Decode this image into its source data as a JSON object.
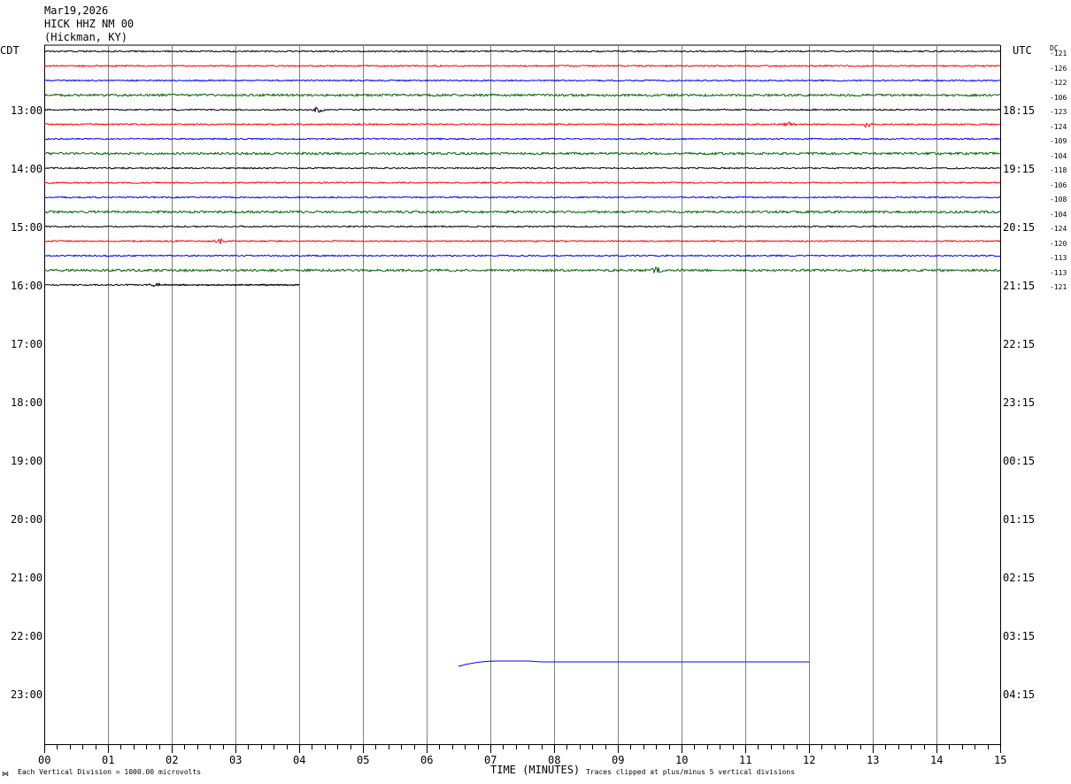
{
  "header": {
    "date": "Mar19,2026",
    "station": "HICK HHZ NM 00",
    "location": "(Hickman, KY)"
  },
  "left_axis_label": "CDT",
  "right_axis_label": "UTC",
  "dc_label": "DC",
  "footer": {
    "left_note": "Each Vertical Division = 1000.00 microvolts",
    "x_axis_title": "TIME (MINUTES)",
    "right_note": "Traces clipped at plus/minus 5 vertical divisions",
    "corner_mark": "⋈"
  },
  "colors": {
    "trace_cycle": [
      "#000000",
      "#ff0000",
      "#0000ff",
      "#006600"
    ],
    "gridline": "#808080"
  },
  "chart_data": {
    "type": "line",
    "subtype": "helicorder",
    "x_axis": {
      "label": "TIME (MINUTES)",
      "range": [
        0,
        15
      ],
      "tick_labels": [
        "00",
        "01",
        "02",
        "03",
        "04",
        "05",
        "06",
        "07",
        "08",
        "09",
        "10",
        "11",
        "12",
        "13",
        "14",
        "15"
      ]
    },
    "left_time_labels": [
      "13:00",
      "14:00",
      "15:00",
      "16:00",
      "17:00",
      "18:00",
      "19:00",
      "20:00",
      "21:00",
      "22:00",
      "23:00"
    ],
    "right_time_labels": [
      "18:15",
      "19:15",
      "20:15",
      "21:15",
      "22:15",
      "23:15",
      "00:15",
      "01:15",
      "02:15",
      "03:15",
      "04:15"
    ],
    "minutes_per_line": 15,
    "dc_offsets": [
      "-121",
      "-126",
      "-122",
      "-106",
      "-123",
      "-124",
      "-109",
      "-104",
      "-118",
      "-106",
      "-108",
      "-104",
      "-124",
      "-120",
      "-113",
      "-113",
      "-121"
    ],
    "traces_recorded": 17,
    "last_trace_end_minute": 4,
    "events": [
      {
        "trace": 4,
        "minute": 4.3,
        "amplitude": "small"
      },
      {
        "trace": 5,
        "minute": 11.7,
        "amplitude": "small"
      },
      {
        "trace": 5,
        "minute": 12.9,
        "amplitude": "small"
      },
      {
        "trace": 13,
        "minute": 2.75,
        "amplitude": "small"
      },
      {
        "trace": 15,
        "minute": 9.6,
        "amplitude": "small"
      },
      {
        "trace": 16,
        "minute": 1.75,
        "amplitude": "small"
      }
    ],
    "artifact_trace": {
      "color": "#0000ff",
      "start_minute": 6.5,
      "end_minute": 12.0
    }
  }
}
